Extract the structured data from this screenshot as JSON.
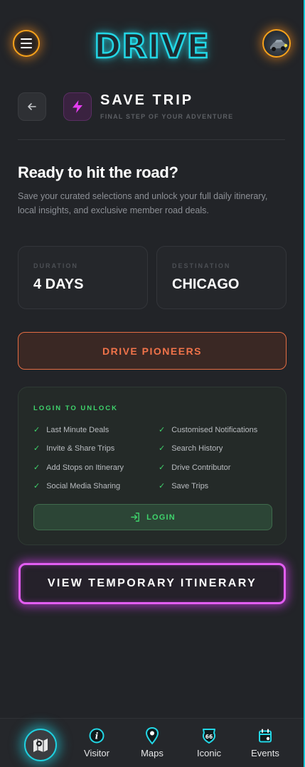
{
  "header": {
    "logo_text": "DRIVE"
  },
  "title_bar": {
    "title": "SAVE TRIP",
    "subtitle": "FINAL STEP OF YOUR ADVENTURE"
  },
  "intro": {
    "heading": "Ready to hit the road?",
    "description": "Save your curated selections and unlock your full daily itinerary, local insights, and exclusive member road deals."
  },
  "stats": {
    "duration_label": "DURATION",
    "duration_value": "4 DAYS",
    "destination_label": "DESTINATION",
    "destination_value": "CHICAGO"
  },
  "pioneers_label": "DRIVE PIONEERS",
  "login_panel": {
    "title": "LOGIN TO UNLOCK",
    "features_left": [
      "Last Minute Deals",
      "Invite & Share Trips",
      "Add Stops on Itinerary",
      "Social Media Sharing"
    ],
    "features_right": [
      "Customised Notifications",
      "Search History",
      "Drive Contributor",
      "Save Trips"
    ],
    "login_label": "LOGIN"
  },
  "itinerary_label": "VIEW TEMPORARY ITINERARY",
  "bottom_nav": {
    "items": [
      {
        "label": "Visitor",
        "icon": "info-icon"
      },
      {
        "label": "Maps",
        "icon": "map-pin-icon"
      },
      {
        "label": "Iconic",
        "icon": "route-66-icon"
      },
      {
        "label": "Events",
        "icon": "calendar-icon"
      }
    ]
  },
  "colors": {
    "accent_cyan": "#23d7e6",
    "accent_orange": "#f7a21b",
    "accent_magenta": "#e35ef2",
    "accent_green": "#3fd46c",
    "pioneer_orange": "#f0734a"
  }
}
